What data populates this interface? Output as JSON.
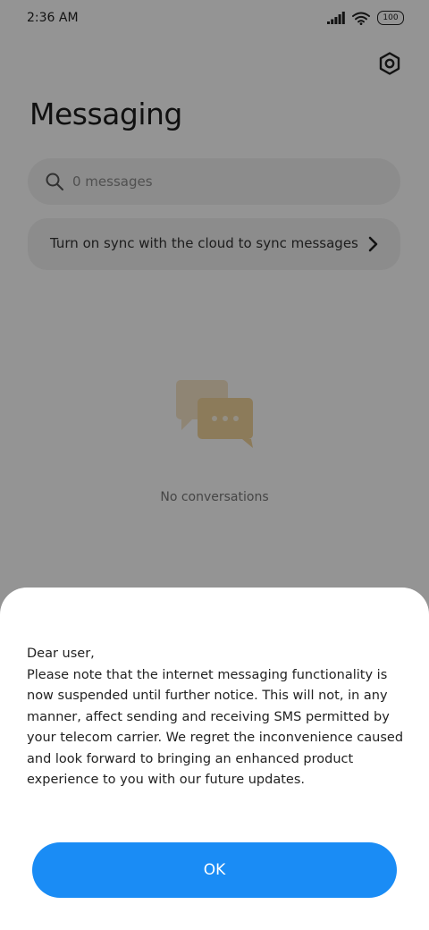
{
  "status_bar": {
    "time": "2:36 AM",
    "battery": "100"
  },
  "header": {
    "title": "Messaging",
    "settings_icon": "gear-icon"
  },
  "search": {
    "placeholder": "0 messages",
    "icon": "search-icon"
  },
  "sync_card": {
    "text": "Turn on sync with the cloud to sync messages",
    "icon": "chevron-right-icon"
  },
  "empty_state": {
    "icon": "chat-bubbles-icon",
    "text": "No conversations"
  },
  "dialog": {
    "greeting": "Dear user,",
    "body": "Please note that the internet messaging functionality is now suspended until further notice. This will not, in any manner, affect sending and receiving SMS permitted by your telecom carrier.  We regret the inconvenience caused and look forward to bringing an enhanced product experience to you with our future updates.",
    "ok_label": "OK"
  },
  "colors": {
    "accent": "#1a8cf5",
    "empty_icon": "#f4d8a8"
  }
}
